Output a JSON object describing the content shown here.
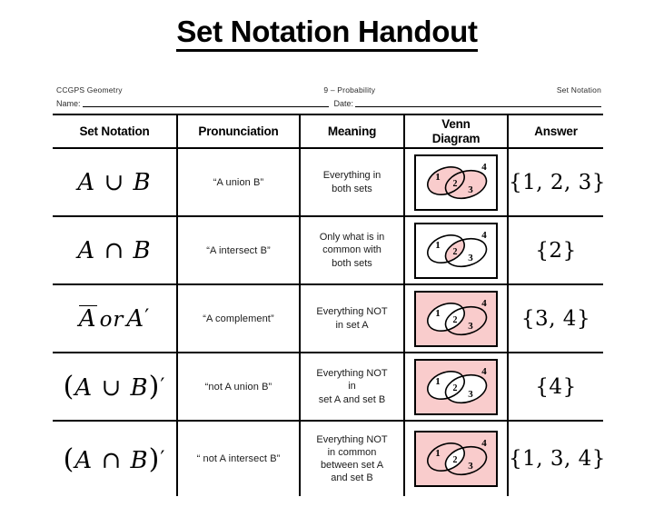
{
  "slide": {
    "title": "Set Notation Handout"
  },
  "worksheet": {
    "course": "CCGPS Geometry",
    "unit": "9 – Probability",
    "topic": "Set Notation",
    "name_label": "Name:",
    "date_label": "Date:"
  },
  "table": {
    "headers": [
      "Set Notation",
      "Pronunciation",
      "Meaning",
      "Venn Diagram",
      "Answer"
    ],
    "rows": [
      {
        "notation_plain": "A ∪ B",
        "pronunciation": "“A union B”",
        "meaning": "Everything in both sets",
        "venn": {
          "shade_outside": false,
          "shade_a_only": true,
          "shade_b_only": true,
          "shade_intersection": true,
          "labels": [
            "1",
            "2",
            "3",
            "4"
          ]
        },
        "answer": "{1, 2, 3}"
      },
      {
        "notation_plain": "A ∩ B",
        "pronunciation": "“A intersect B”",
        "meaning": "Only what is in common with both sets",
        "venn": {
          "shade_outside": false,
          "shade_a_only": false,
          "shade_b_only": false,
          "shade_intersection": true,
          "labels": [
            "1",
            "2",
            "3",
            "4"
          ]
        },
        "answer": "{2}"
      },
      {
        "notation_plain": "A̅ or A'",
        "pronunciation": "“A complement”",
        "meaning": "Everything NOT in set A",
        "venn": {
          "shade_outside": true,
          "shade_a_only": false,
          "shade_b_only": true,
          "shade_intersection": false,
          "labels": [
            "1",
            "2",
            "3",
            "4"
          ]
        },
        "answer": "{3, 4}"
      },
      {
        "notation_plain": "(A ∪ B)'",
        "pronunciation": "“not A union B”",
        "meaning": "Everything NOT in set A and set B",
        "venn": {
          "shade_outside": true,
          "shade_a_only": false,
          "shade_b_only": false,
          "shade_intersection": false,
          "labels": [
            "1",
            "2",
            "3",
            "4"
          ]
        },
        "answer": "{4}"
      },
      {
        "notation_plain": "(A ∩ B)'",
        "pronunciation": "“ not A intersect B”",
        "meaning": "Everything NOT in common between set A and set B",
        "venn": {
          "shade_outside": true,
          "shade_a_only": true,
          "shade_b_only": true,
          "shade_intersection": false,
          "labels": [
            "1",
            "2",
            "3",
            "4"
          ]
        },
        "answer": "{1, 3, 4}"
      }
    ]
  },
  "meaning_lines": [
    [
      "Everything in",
      "both sets"
    ],
    [
      "Only what is in",
      "common with",
      "both sets"
    ],
    [
      "Everything NOT",
      "in set A"
    ],
    [
      "Everything NOT",
      "in",
      "set A and set B"
    ],
    [
      "Everything NOT",
      "in common",
      "between set A",
      "and set B"
    ]
  ],
  "colors": {
    "shade": "#f9cccc",
    "ink": "#000000",
    "faint_ink": "#2b2b2b",
    "page": "#ffffff"
  }
}
